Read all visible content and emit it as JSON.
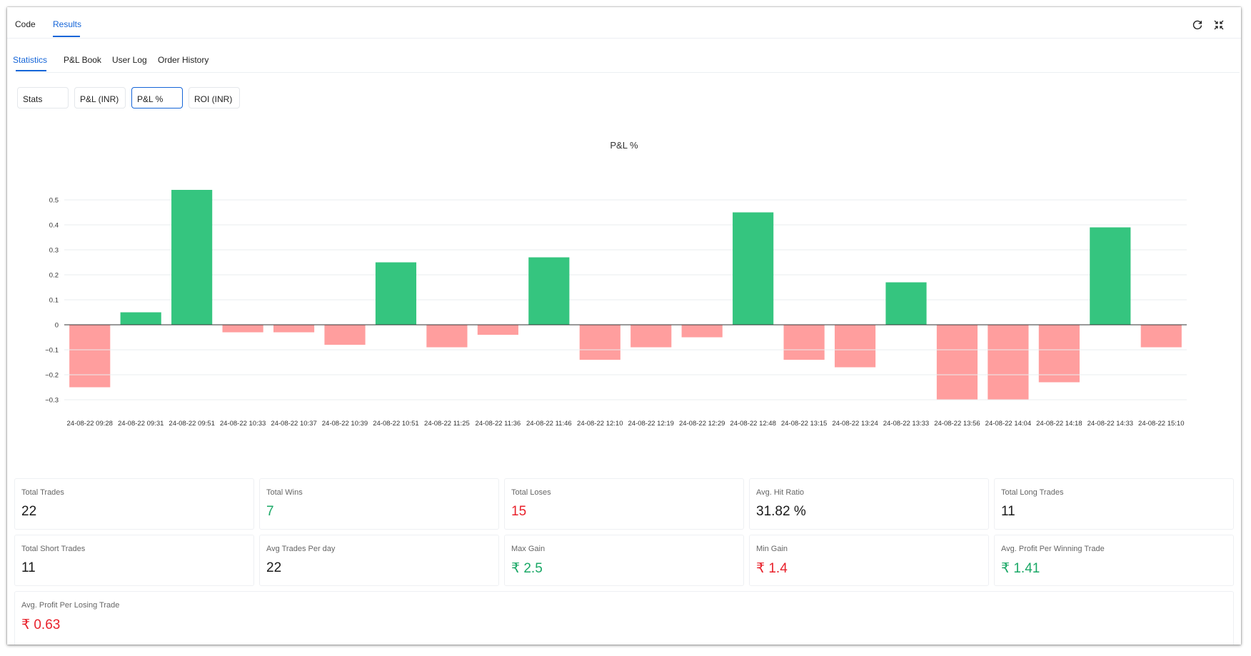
{
  "top_tabs": [
    {
      "label": "Code",
      "active": false
    },
    {
      "label": "Results",
      "active": true
    }
  ],
  "icons": {
    "refresh": "refresh-icon",
    "collapse": "collapse-icon"
  },
  "sub_tabs": [
    {
      "label": "Statistics",
      "active": true
    },
    {
      "label": "P&L Book",
      "active": false
    },
    {
      "label": "User Log",
      "active": false
    },
    {
      "label": "Order History",
      "active": false
    }
  ],
  "chart_buttons": [
    {
      "label": "Stats",
      "active": false
    },
    {
      "label": "P&L (INR)",
      "active": false
    },
    {
      "label": "P&L %",
      "active": true
    },
    {
      "label": "ROI (INR)",
      "active": false
    }
  ],
  "colors": {
    "accent": "#1565d8",
    "positive_bar": "#35c57f",
    "negative_bar": "#ff9e9e",
    "green_text": "#1aa866",
    "red_text": "#e8212b"
  },
  "chart_data": {
    "type": "bar",
    "title": "P&L %",
    "xlabel": "",
    "ylabel": "",
    "ylim": [
      -0.3,
      0.5
    ],
    "y_ticks": [
      0.5,
      0.4,
      0.3,
      0.2,
      0.1,
      0,
      -0.1,
      -0.2,
      -0.3
    ],
    "y_tick_labels": [
      "0.5",
      "0.4",
      "0.3",
      "0.2",
      "0.1",
      "0",
      "−0.1",
      "−0.2",
      "−0.3"
    ],
    "grid": true,
    "categories": [
      "24-08-22 09:28",
      "24-08-22 09:31",
      "24-08-22 09:51",
      "24-08-22 10:33",
      "24-08-22 10:37",
      "24-08-22 10:39",
      "24-08-22 10:51",
      "24-08-22 11:25",
      "24-08-22 11:36",
      "24-08-22 11:46",
      "24-08-22 12:10",
      "24-08-22 12:19",
      "24-08-22 12:29",
      "24-08-22 12:48",
      "24-08-22 13:15",
      "24-08-22 13:24",
      "24-08-22 13:33",
      "24-08-22 13:56",
      "24-08-22 14:04",
      "24-08-22 14:18",
      "24-08-22 14:33",
      "24-08-22 15:10"
    ],
    "values": [
      -0.25,
      0.05,
      0.54,
      -0.03,
      -0.03,
      -0.08,
      0.25,
      -0.09,
      -0.04,
      0.27,
      -0.14,
      -0.09,
      -0.05,
      0.45,
      -0.14,
      -0.17,
      0.17,
      -0.3,
      -0.3,
      -0.23,
      0.39,
      -0.09
    ]
  },
  "stats": [
    {
      "label": "Total Trades",
      "value": "22",
      "tone": "default"
    },
    {
      "label": "Total Wins",
      "value": "7",
      "tone": "green"
    },
    {
      "label": "Total Loses",
      "value": "15",
      "tone": "red"
    },
    {
      "label": "Avg. Hit Ratio",
      "value": "31.82 %",
      "tone": "default"
    },
    {
      "label": "Total Long Trades",
      "value": "11",
      "tone": "default"
    },
    {
      "label": "Total Short Trades",
      "value": "11",
      "tone": "default"
    },
    {
      "label": "Avg Trades Per day",
      "value": "22",
      "tone": "default"
    },
    {
      "label": "Max Gain",
      "value": "₹ 2.5",
      "tone": "green"
    },
    {
      "label": "Min Gain",
      "value": "₹ 1.4",
      "tone": "red"
    },
    {
      "label": "Avg. Profit Per Winning Trade",
      "value": "₹ 1.41",
      "tone": "green"
    },
    {
      "label": "Avg. Profit Per Losing Trade",
      "value": "₹ 0.63",
      "tone": "red"
    }
  ]
}
